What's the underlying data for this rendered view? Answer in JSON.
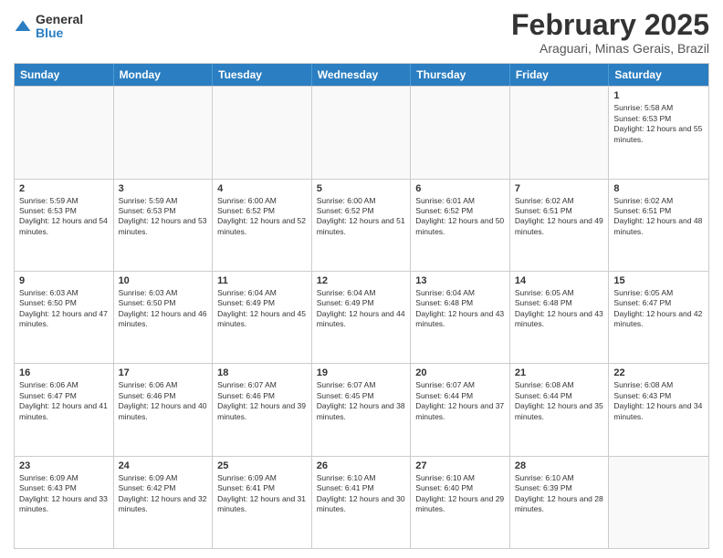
{
  "logo": {
    "general": "General",
    "blue": "Blue"
  },
  "header": {
    "month": "February 2025",
    "location": "Araguari, Minas Gerais, Brazil"
  },
  "weekdays": [
    "Sunday",
    "Monday",
    "Tuesday",
    "Wednesday",
    "Thursday",
    "Friday",
    "Saturday"
  ],
  "rows": [
    [
      {
        "day": "",
        "empty": true
      },
      {
        "day": "",
        "empty": true
      },
      {
        "day": "",
        "empty": true
      },
      {
        "day": "",
        "empty": true
      },
      {
        "day": "",
        "empty": true
      },
      {
        "day": "",
        "empty": true
      },
      {
        "day": "1",
        "sunrise": "Sunrise: 5:58 AM",
        "sunset": "Sunset: 6:53 PM",
        "daylight": "Daylight: 12 hours and 55 minutes."
      }
    ],
    [
      {
        "day": "2",
        "sunrise": "Sunrise: 5:59 AM",
        "sunset": "Sunset: 6:53 PM",
        "daylight": "Daylight: 12 hours and 54 minutes."
      },
      {
        "day": "3",
        "sunrise": "Sunrise: 5:59 AM",
        "sunset": "Sunset: 6:53 PM",
        "daylight": "Daylight: 12 hours and 53 minutes."
      },
      {
        "day": "4",
        "sunrise": "Sunrise: 6:00 AM",
        "sunset": "Sunset: 6:52 PM",
        "daylight": "Daylight: 12 hours and 52 minutes."
      },
      {
        "day": "5",
        "sunrise": "Sunrise: 6:00 AM",
        "sunset": "Sunset: 6:52 PM",
        "daylight": "Daylight: 12 hours and 51 minutes."
      },
      {
        "day": "6",
        "sunrise": "Sunrise: 6:01 AM",
        "sunset": "Sunset: 6:52 PM",
        "daylight": "Daylight: 12 hours and 50 minutes."
      },
      {
        "day": "7",
        "sunrise": "Sunrise: 6:02 AM",
        "sunset": "Sunset: 6:51 PM",
        "daylight": "Daylight: 12 hours and 49 minutes."
      },
      {
        "day": "8",
        "sunrise": "Sunrise: 6:02 AM",
        "sunset": "Sunset: 6:51 PM",
        "daylight": "Daylight: 12 hours and 48 minutes."
      }
    ],
    [
      {
        "day": "9",
        "sunrise": "Sunrise: 6:03 AM",
        "sunset": "Sunset: 6:50 PM",
        "daylight": "Daylight: 12 hours and 47 minutes."
      },
      {
        "day": "10",
        "sunrise": "Sunrise: 6:03 AM",
        "sunset": "Sunset: 6:50 PM",
        "daylight": "Daylight: 12 hours and 46 minutes."
      },
      {
        "day": "11",
        "sunrise": "Sunrise: 6:04 AM",
        "sunset": "Sunset: 6:49 PM",
        "daylight": "Daylight: 12 hours and 45 minutes."
      },
      {
        "day": "12",
        "sunrise": "Sunrise: 6:04 AM",
        "sunset": "Sunset: 6:49 PM",
        "daylight": "Daylight: 12 hours and 44 minutes."
      },
      {
        "day": "13",
        "sunrise": "Sunrise: 6:04 AM",
        "sunset": "Sunset: 6:48 PM",
        "daylight": "Daylight: 12 hours and 43 minutes."
      },
      {
        "day": "14",
        "sunrise": "Sunrise: 6:05 AM",
        "sunset": "Sunset: 6:48 PM",
        "daylight": "Daylight: 12 hours and 43 minutes."
      },
      {
        "day": "15",
        "sunrise": "Sunrise: 6:05 AM",
        "sunset": "Sunset: 6:47 PM",
        "daylight": "Daylight: 12 hours and 42 minutes."
      }
    ],
    [
      {
        "day": "16",
        "sunrise": "Sunrise: 6:06 AM",
        "sunset": "Sunset: 6:47 PM",
        "daylight": "Daylight: 12 hours and 41 minutes."
      },
      {
        "day": "17",
        "sunrise": "Sunrise: 6:06 AM",
        "sunset": "Sunset: 6:46 PM",
        "daylight": "Daylight: 12 hours and 40 minutes."
      },
      {
        "day": "18",
        "sunrise": "Sunrise: 6:07 AM",
        "sunset": "Sunset: 6:46 PM",
        "daylight": "Daylight: 12 hours and 39 minutes."
      },
      {
        "day": "19",
        "sunrise": "Sunrise: 6:07 AM",
        "sunset": "Sunset: 6:45 PM",
        "daylight": "Daylight: 12 hours and 38 minutes."
      },
      {
        "day": "20",
        "sunrise": "Sunrise: 6:07 AM",
        "sunset": "Sunset: 6:44 PM",
        "daylight": "Daylight: 12 hours and 37 minutes."
      },
      {
        "day": "21",
        "sunrise": "Sunrise: 6:08 AM",
        "sunset": "Sunset: 6:44 PM",
        "daylight": "Daylight: 12 hours and 35 minutes."
      },
      {
        "day": "22",
        "sunrise": "Sunrise: 6:08 AM",
        "sunset": "Sunset: 6:43 PM",
        "daylight": "Daylight: 12 hours and 34 minutes."
      }
    ],
    [
      {
        "day": "23",
        "sunrise": "Sunrise: 6:09 AM",
        "sunset": "Sunset: 6:43 PM",
        "daylight": "Daylight: 12 hours and 33 minutes."
      },
      {
        "day": "24",
        "sunrise": "Sunrise: 6:09 AM",
        "sunset": "Sunset: 6:42 PM",
        "daylight": "Daylight: 12 hours and 32 minutes."
      },
      {
        "day": "25",
        "sunrise": "Sunrise: 6:09 AM",
        "sunset": "Sunset: 6:41 PM",
        "daylight": "Daylight: 12 hours and 31 minutes."
      },
      {
        "day": "26",
        "sunrise": "Sunrise: 6:10 AM",
        "sunset": "Sunset: 6:41 PM",
        "daylight": "Daylight: 12 hours and 30 minutes."
      },
      {
        "day": "27",
        "sunrise": "Sunrise: 6:10 AM",
        "sunset": "Sunset: 6:40 PM",
        "daylight": "Daylight: 12 hours and 29 minutes."
      },
      {
        "day": "28",
        "sunrise": "Sunrise: 6:10 AM",
        "sunset": "Sunset: 6:39 PM",
        "daylight": "Daylight: 12 hours and 28 minutes."
      },
      {
        "day": "",
        "empty": true
      }
    ]
  ]
}
